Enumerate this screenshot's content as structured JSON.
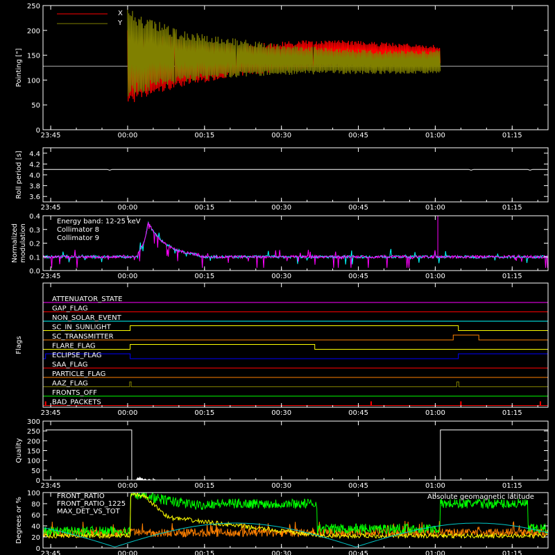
{
  "colors": {
    "background": "#000000",
    "axis": "#ffffff",
    "x_series": "#ff0000",
    "y_series": "#808000",
    "collimator8": "#00ffff",
    "collimator9": "#ff00ff",
    "front_ratio": "#ffff00",
    "front_ratio_1225": "#00ff00",
    "max_det_vs_tot": "#ff8000",
    "geomag": "#00c8c8"
  },
  "chart_data": [
    {
      "type": "line",
      "panel": "pointing",
      "ylabel": "Pointing [\"]",
      "ylim": [
        0,
        250
      ],
      "yticks": [
        "0",
        "50",
        "100",
        "150",
        "200",
        "250"
      ],
      "xticks": [
        "23:45",
        "00:00",
        "00:15",
        "00:30",
        "00:45",
        "01:00",
        "01:15"
      ],
      "legend": "top-left",
      "series": [
        {
          "name": "X",
          "color": "#ff0000",
          "start": "00:00",
          "end": "01:01",
          "upper_envelope": [
            [
              0,
              200
            ],
            [
              10,
              185
            ],
            [
              20,
              172
            ],
            [
              30,
              178
            ],
            [
              40,
              182
            ],
            [
              50,
              176
            ],
            [
              61,
              170
            ]
          ],
          "lower_envelope": [
            [
              0,
              50
            ],
            [
              10,
              85
            ],
            [
              20,
              105
            ],
            [
              30,
              118
            ],
            [
              40,
              124
            ],
            [
              50,
              128
            ],
            [
              61,
              130
            ]
          ]
        },
        {
          "name": "Y",
          "color": "#808000",
          "start": "00:00",
          "end": "01:01",
          "upper_envelope": [
            [
              0,
              245
            ],
            [
              10,
              200
            ],
            [
              20,
              185
            ],
            [
              30,
              172
            ],
            [
              40,
              165
            ],
            [
              50,
              160
            ],
            [
              61,
              160
            ]
          ],
          "lower_envelope": [
            [
              0,
              65
            ],
            [
              10,
              95
            ],
            [
              20,
              105
            ],
            [
              30,
              110
            ],
            [
              40,
              112
            ],
            [
              50,
              112
            ],
            [
              61,
              112
            ]
          ]
        }
      ],
      "reference_line": 128
    },
    {
      "type": "line",
      "panel": "roll_period",
      "ylabel": "Roll period [s]",
      "ylim": [
        3.5,
        4.5
      ],
      "yticks": [
        "3.6",
        "3.8",
        "4.0",
        "4.2",
        "4.4"
      ],
      "xticks": [
        "23:45",
        "00:00",
        "00:15",
        "00:30",
        "00:45",
        "01:00",
        "01:15"
      ],
      "series": [
        {
          "value": 4.1
        }
      ]
    },
    {
      "type": "line",
      "panel": "modulation",
      "ylabel": [
        "Normalized",
        "modulation"
      ],
      "ylim": [
        0,
        0.4
      ],
      "yticks": [
        "0.0",
        "0.1",
        "0.2",
        "0.3",
        "0.4"
      ],
      "xticks": [
        "23:45",
        "00:00",
        "00:15",
        "00:30",
        "00:45",
        "01:00",
        "01:15"
      ],
      "annotation": "Energy band: 12-25 keV",
      "legend": "top-left",
      "baseline": 0.1,
      "peak": {
        "time_min": 4,
        "value": 0.35
      },
      "series": [
        {
          "name": "Collimator 8",
          "color": "#00ffff"
        },
        {
          "name": "Collimator 9",
          "color": "#ff00ff"
        }
      ]
    },
    {
      "type": "line",
      "panel": "flags",
      "ylabel": "Flags",
      "xticks": [
        "23:45",
        "00:00",
        "00:15",
        "00:30",
        "00:45",
        "01:00",
        "01:15"
      ],
      "flags": [
        {
          "name": "ATTENUATOR_STATE",
          "color": "#ff00ff",
          "on": []
        },
        {
          "name": "GAP_FLAG",
          "color": "#ff0000",
          "on": []
        },
        {
          "name": "NON_SOLAR_EVENT",
          "color": "#00ffff",
          "on": []
        },
        {
          "name": "SC_IN_SUNLIGHT",
          "color": "#ffff00",
          "on": [
            [
              0.5,
              64.5
            ]
          ]
        },
        {
          "name": "SC_TRANSMITTER",
          "color": "#ff8000",
          "on": [
            [
              63.5,
              68.5
            ]
          ]
        },
        {
          "name": "FLARE_FLAG",
          "color": "#ffff00",
          "on": [
            [
              0.5,
              36.5
            ]
          ]
        },
        {
          "name": "ECLIPSE_FLAG",
          "color": "#0000ff",
          "on": [
            [
              -16,
              0.5
            ],
            [
              64.5,
              82
            ]
          ]
        },
        {
          "name": "SAA_FLAG",
          "color": "#ff0000",
          "on": []
        },
        {
          "name": "PARTICLE_FLAG",
          "color": "#ff8000",
          "on": []
        },
        {
          "name": "AAZ_FLAG",
          "color": "#808000",
          "on": [
            [
              0.4,
              0.7
            ],
            [
              64.2,
              64.6
            ]
          ]
        },
        {
          "name": "FRONTS_OFF",
          "color": "#00ff00",
          "on": []
        },
        {
          "name": "BAD_PACKETS",
          "color": "#ff0000",
          "spikes": [
            -16,
            47.5,
            65,
            80.5
          ]
        }
      ]
    },
    {
      "type": "line",
      "panel": "quality",
      "ylabel": "Quality",
      "ylim": [
        0,
        300
      ],
      "yticks": [
        "0",
        "50",
        "100",
        "150",
        "200",
        "250",
        "300"
      ],
      "xticks": [
        "23:45",
        "00:00",
        "00:15",
        "00:30",
        "00:45",
        "01:00",
        "01:15"
      ],
      "series": [
        {
          "segments": [
            [
              -16,
              0.8,
              255
            ],
            [
              0.8,
              61,
              0
            ],
            [
              61,
              82,
              255
            ]
          ],
          "blips": [
            [
              2,
              15
            ],
            [
              2.4,
              18
            ],
            [
              2.8,
              12
            ],
            [
              3.4,
              8
            ],
            [
              4.2,
              6
            ],
            [
              5.2,
              5
            ]
          ]
        }
      ]
    },
    {
      "type": "line",
      "panel": "ratios",
      "ylabel": "Degrees or %",
      "ylim": [
        0,
        100
      ],
      "yticks": [
        "0",
        "20",
        "40",
        "60",
        "80",
        "100"
      ],
      "xticks": [
        "23:45",
        "00:00",
        "00:15",
        "00:30",
        "00:45",
        "01:00",
        "01:15"
      ],
      "legend": "top-left",
      "series": [
        {
          "name": "FRONT_RATIO",
          "color": "#ffff00"
        },
        {
          "name": "FRONT_RATIO_1225",
          "color": "#00ff00"
        },
        {
          "name": "MAX_DET_VS_TOT",
          "color": "#ff8000"
        },
        {
          "name": "Absolute geomagnetic latitude",
          "color": "#00c8c8"
        }
      ]
    }
  ]
}
